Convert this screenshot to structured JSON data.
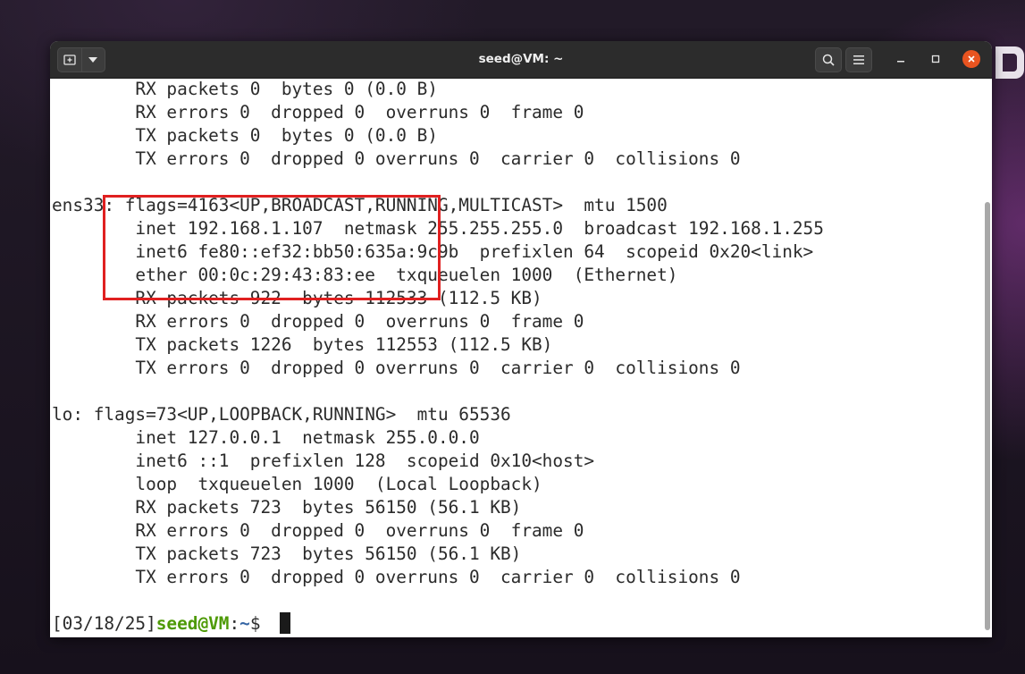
{
  "window": {
    "title": "seed@VM: ~"
  },
  "terminal": {
    "lines": [
      "        RX packets 0  bytes 0 (0.0 B)",
      "        RX errors 0  dropped 0  overruns 0  frame 0",
      "        TX packets 0  bytes 0 (0.0 B)",
      "        TX errors 0  dropped 0 overruns 0  carrier 0  collisions 0",
      "",
      "ens33: flags=4163<UP,BROADCAST,RUNNING,MULTICAST>  mtu 1500",
      "        inet 192.168.1.107  netmask 255.255.255.0  broadcast 192.168.1.255",
      "        inet6 fe80::ef32:bb50:635a:9c9b  prefixlen 64  scopeid 0x20<link>",
      "        ether 00:0c:29:43:83:ee  txqueuelen 1000  (Ethernet)",
      "        RX packets 922  bytes 112533 (112.5 KB)",
      "        RX errors 0  dropped 0  overruns 0  frame 0",
      "        TX packets 1226  bytes 112553 (112.5 KB)",
      "        TX errors 0  dropped 0 overruns 0  carrier 0  collisions 0",
      "",
      "lo: flags=73<UP,LOOPBACK,RUNNING>  mtu 65536",
      "        inet 127.0.0.1  netmask 255.0.0.0",
      "        inet6 ::1  prefixlen 128  scopeid 0x10<host>",
      "        loop  txqueuelen 1000  (Local Loopback)",
      "        RX packets 723  bytes 56150 (56.1 KB)",
      "        RX errors 0  dropped 0  overruns 0  frame 0",
      "        TX packets 723  bytes 56150 (56.1 KB)",
      "        TX errors 0  dropped 0 overruns 0  carrier 0  collisions 0",
      ""
    ],
    "prompt": {
      "date": "[03/18/25]",
      "user_host": "seed@VM",
      "separator": ":",
      "path": "~",
      "symbol": "$ "
    }
  },
  "icons": {
    "new_tab": "new-tab-icon",
    "menu_dropdown": "chevron-down-icon",
    "search": "search-icon",
    "hamburger": "hamburger-menu-icon",
    "minimize": "minimize-icon",
    "maximize": "maximize-icon",
    "close": "close-icon"
  },
  "colors": {
    "annotation_box": "#e02020",
    "prompt_user": "#4e9a06",
    "prompt_path": "#3465a4",
    "close_button": "#e95420"
  }
}
